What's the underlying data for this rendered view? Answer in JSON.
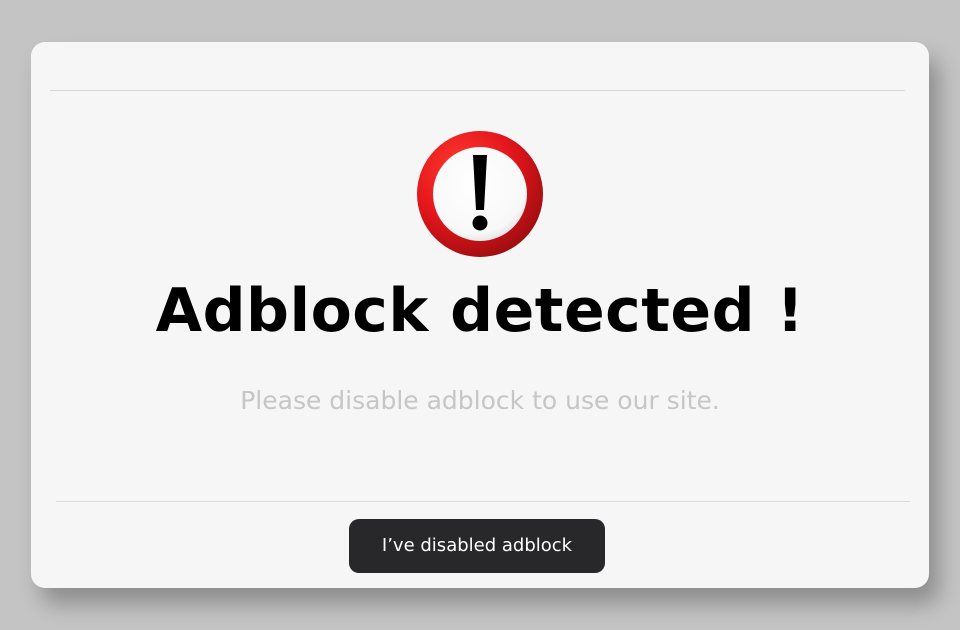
{
  "dialog": {
    "icon": "exclamation-warning-icon",
    "title": "Adblock detected !",
    "message": "Please disable adblock to use our site.",
    "button_label": "I’ve disabled adblock"
  },
  "colors": {
    "page_background": "#c4c4c4",
    "dialog_background": "#f6f6f6",
    "icon_red": "#e4161c",
    "icon_dark_red": "#9d0d10",
    "button_background": "#28282a",
    "message_text": "#c6c6c6"
  }
}
